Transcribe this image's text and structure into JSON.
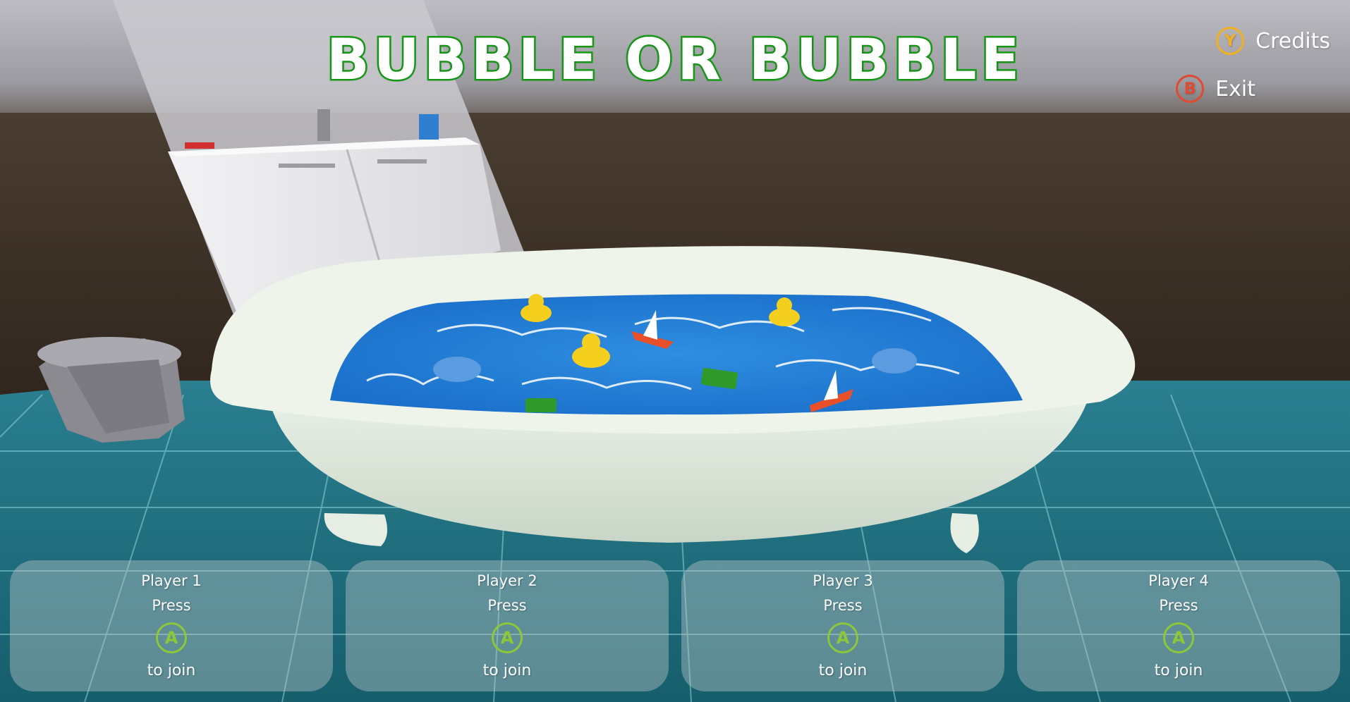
{
  "title": "BUBBLE OR BUBBLE",
  "menu": {
    "credits": {
      "button": "Y",
      "label": "Credits",
      "color": "#f0b020"
    },
    "exit": {
      "button": "B",
      "label": "Exit",
      "color": "#e04a30"
    }
  },
  "players": [
    {
      "name": "Player 1",
      "press": "Press",
      "button": "A",
      "join": "to join"
    },
    {
      "name": "Player 2",
      "press": "Press",
      "button": "A",
      "join": "to join"
    },
    {
      "name": "Player 3",
      "press": "Press",
      "button": "A",
      "join": "to join"
    },
    {
      "name": "Player 4",
      "press": "Press",
      "button": "A",
      "join": "to join"
    }
  ],
  "colors": {
    "title_outline": "#1aa31a",
    "join_button": "#8cc83a",
    "water": "#1e7fd6",
    "floor_tile": "#1d6f80"
  }
}
